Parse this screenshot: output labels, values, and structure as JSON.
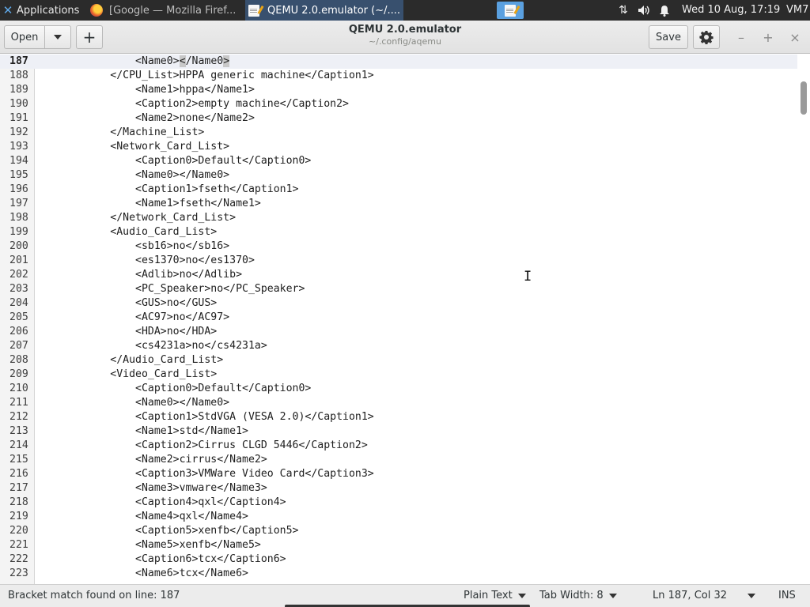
{
  "panel": {
    "applications_label": "Applications",
    "firefox_task_label": "[Google — Mozilla Firef...",
    "editor_task_label": "QEMU 2.0.emulator (~/....",
    "clock": "Wed 10 Aug, 17:19",
    "vm_label": "VM7",
    "icons": {
      "apps": "xfce-icon",
      "firefox": "firefox-icon",
      "editor": "notepad-icon",
      "network": "network-updown-icon",
      "volume": "speaker-icon",
      "notifications": "bell-icon"
    }
  },
  "header": {
    "open_label": "Open",
    "new_label": "+",
    "title": "QEMU 2.0.emulator",
    "subtitle": "~/.config/aqemu",
    "save_label": "Save",
    "settings_icon": "gear-icon",
    "minimize_glyph": "–",
    "maximize_glyph": "+",
    "close_glyph": "×"
  },
  "editor": {
    "current_line": 187,
    "lines": [
      {
        "n": "187",
        "pre": "                <Name0>",
        "bm1": "<",
        "mid": "/Name0",
        "bm2": ">",
        "post": ""
      },
      {
        "n": "188",
        "code": "            </CPU_List>HPPA generic machine</Caption1>"
      },
      {
        "n": "189",
        "code": "                <Name1>hppa</Name1>"
      },
      {
        "n": "190",
        "code": "                <Caption2>empty machine</Caption2>"
      },
      {
        "n": "191",
        "code": "                <Name2>none</Name2>"
      },
      {
        "n": "192",
        "code": "            </Machine_List>"
      },
      {
        "n": "193",
        "code": "            <Network_Card_List>"
      },
      {
        "n": "194",
        "code": "                <Caption0>Default</Caption0>"
      },
      {
        "n": "195",
        "code": "                <Name0></Name0>"
      },
      {
        "n": "196",
        "code": "                <Caption1>fseth</Caption1>"
      },
      {
        "n": "197",
        "code": "                <Name1>fseth</Name1>"
      },
      {
        "n": "198",
        "code": "            </Network_Card_List>"
      },
      {
        "n": "199",
        "code": "            <Audio_Card_List>"
      },
      {
        "n": "200",
        "code": "                <sb16>no</sb16>"
      },
      {
        "n": "201",
        "code": "                <es1370>no</es1370>"
      },
      {
        "n": "202",
        "code": "                <Adlib>no</Adlib>"
      },
      {
        "n": "203",
        "code": "                <PC_Speaker>no</PC_Speaker>"
      },
      {
        "n": "204",
        "code": "                <GUS>no</GUS>"
      },
      {
        "n": "205",
        "code": "                <AC97>no</AC97>"
      },
      {
        "n": "206",
        "code": "                <HDA>no</HDA>"
      },
      {
        "n": "207",
        "code": "                <cs4231a>no</cs4231a>"
      },
      {
        "n": "208",
        "code": "            </Audio_Card_List>"
      },
      {
        "n": "209",
        "code": "            <Video_Card_List>"
      },
      {
        "n": "210",
        "code": "                <Caption0>Default</Caption0>"
      },
      {
        "n": "211",
        "code": "                <Name0></Name0>"
      },
      {
        "n": "212",
        "code": "                <Caption1>StdVGA (VESA 2.0)</Caption1>"
      },
      {
        "n": "213",
        "code": "                <Name1>std</Name1>"
      },
      {
        "n": "214",
        "code": "                <Caption2>Cirrus CLGD 5446</Caption2>"
      },
      {
        "n": "215",
        "code": "                <Name2>cirrus</Name2>"
      },
      {
        "n": "216",
        "code": "                <Caption3>VMWare Video Card</Caption3>"
      },
      {
        "n": "217",
        "code": "                <Name3>vmware</Name3>"
      },
      {
        "n": "218",
        "code": "                <Caption4>qxl</Caption4>"
      },
      {
        "n": "219",
        "code": "                <Name4>qxl</Name4>"
      },
      {
        "n": "220",
        "code": "                <Caption5>xenfb</Caption5>"
      },
      {
        "n": "221",
        "code": "                <Name5>xenfb</Name5>"
      },
      {
        "n": "222",
        "code": "                <Caption6>tcx</Caption6>"
      },
      {
        "n": "223",
        "code": "                <Name6>tcx</Name6>"
      }
    ]
  },
  "statusbar": {
    "message": "Bracket match found on line: 187",
    "filetype": "Plain Text",
    "tab_width": "Tab Width: 8",
    "position": "Ln 187, Col 32",
    "mode": "INS"
  },
  "colors": {
    "panel_bg": "#2b2b2b",
    "active_task_bg": "#38506e",
    "workspace_bg": "#5aa0e0",
    "current_line_bg": "#eef0f6"
  }
}
